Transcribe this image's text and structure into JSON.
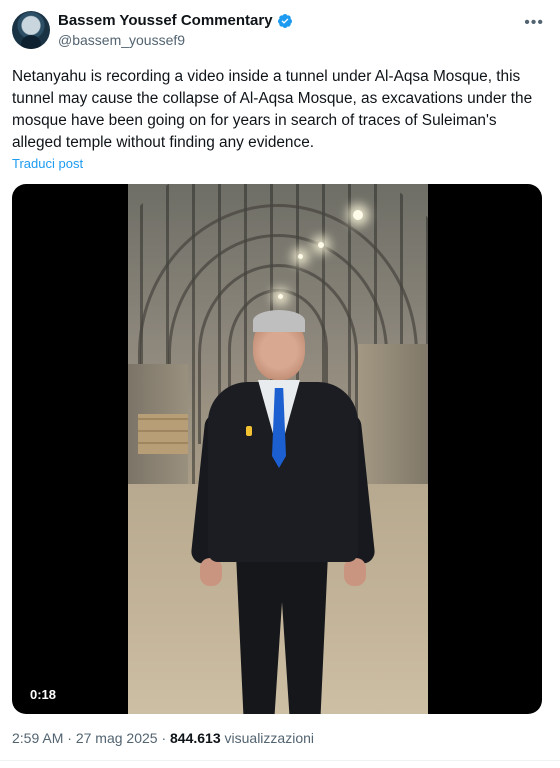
{
  "author": {
    "display_name": "Bassem Youssef Commentary",
    "handle": "@bassem_youssef9",
    "verified_icon": "verified-badge-icon",
    "verified_color": "#1d9bf0"
  },
  "tweet": {
    "text": "Netanyahu is recording a video inside a tunnel under Al-Aqsa Mosque, this tunnel may cause the collapse of Al-Aqsa Mosque, as excavations under the mosque have been going on for years in search of traces of Suleiman's alleged temple without finding any evidence.",
    "translate_label": "Traduci post"
  },
  "media": {
    "duration": "0:18"
  },
  "meta": {
    "time": "2:59 AM",
    "separator": "·",
    "date": "27 mag 2025",
    "views_count": "844.613",
    "views_label": "visualizzazioni"
  },
  "more_icon": "more-options-icon",
  "colors": {
    "link": "#1d9bf0",
    "secondary_text": "#536471",
    "primary_text": "#0f1419"
  }
}
